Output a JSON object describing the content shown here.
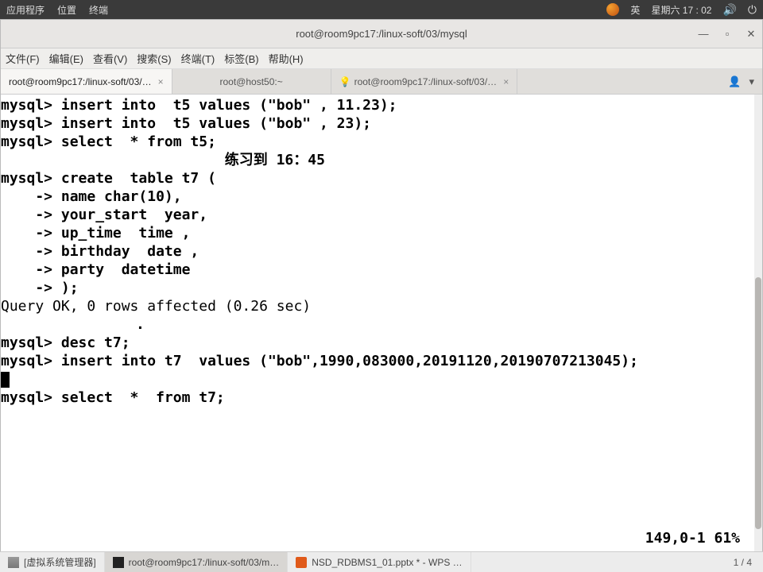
{
  "panel": {
    "app_menu": "应用程序",
    "places": "位置",
    "terminal": "终端",
    "lang": "英",
    "clock": "星期六 17 : 02"
  },
  "window": {
    "title": "root@room9pc17:/linux-soft/03/mysql"
  },
  "menu": {
    "file": "文件(F)",
    "edit": "编辑(E)",
    "view": "查看(V)",
    "search": "搜索(S)",
    "terminal": "终端(T)",
    "tabs": "标签(B)",
    "help": "帮助(H)"
  },
  "tabs": {
    "0": {
      "label": "root@room9pc17:/linux-soft/03/…"
    },
    "1": {
      "label": "root@host50:~"
    },
    "2": {
      "label": "root@room9pc17:/linux-soft/03/…"
    }
  },
  "term": {
    "l1": "mysql> insert into  t5 values (\"bob\" , 11.23);",
    "l2": "mysql> insert into  t5 values (\"bob\" , 23);",
    "l3": "mysql> select  * from t5;",
    "l4": "                          练习到 16：45",
    "l5": "",
    "l6": "",
    "l7": "mysql> create  table t7 (",
    "l8": "    -> name char(10),",
    "l9": "    -> your_start  year,",
    "l10": "    -> up_time  time ,",
    "l11": "    -> birthday  date ,",
    "l12": "    -> party  datetime",
    "l13": "    -> );",
    "l14": "Query OK, 0 rows affected (0.26 sec)",
    "dot": ".",
    "l15": "mysql> desc t7;",
    "l16": "mysql> insert into t7  values (\"bob\",1990,083000,20191120,20190707213045);",
    "l17": "mysql> select  *  from t7;",
    "status": "149,0-1        61%"
  },
  "taskbar": {
    "vmm": "[虚拟系统管理器]",
    "term": "root@room9pc17:/linux-soft/03/m…",
    "wps": "NSD_RDBMS1_01.pptx * - WPS …",
    "ws": "1 / 4"
  }
}
